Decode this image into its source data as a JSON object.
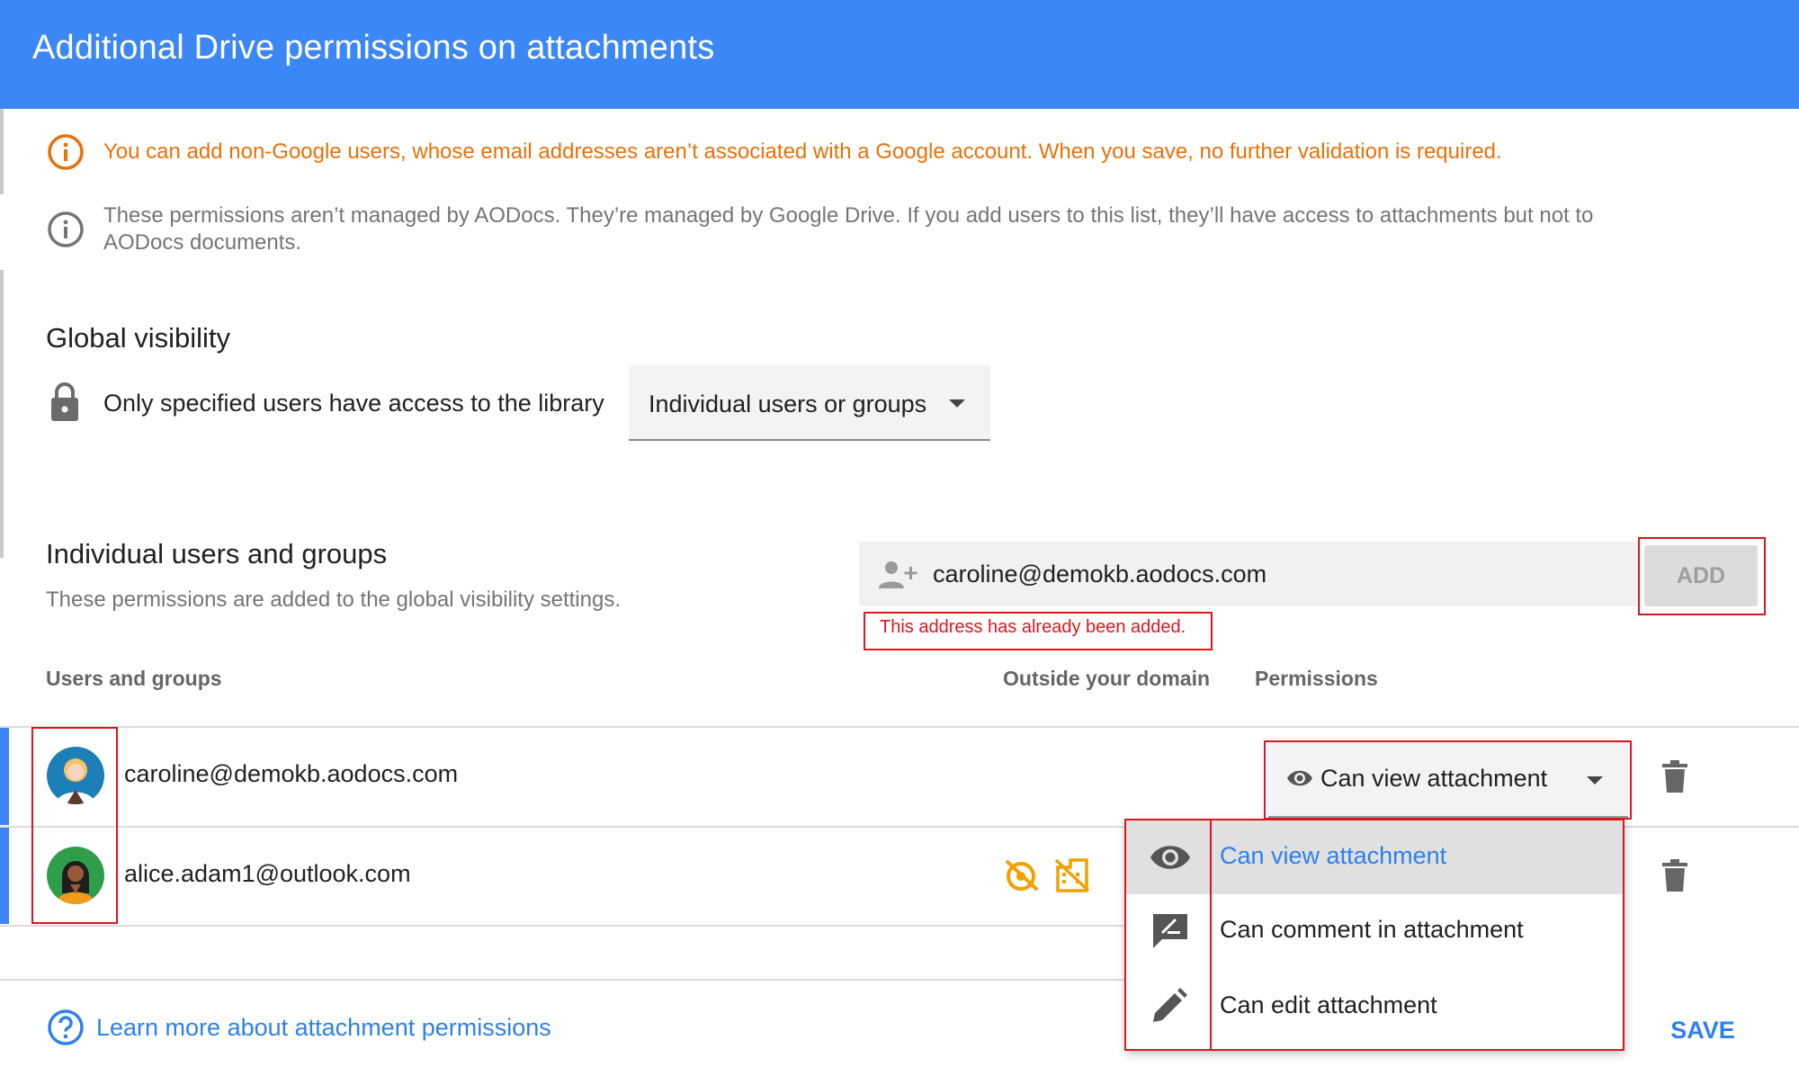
{
  "dialog": {
    "title": "Additional Drive permissions on attachments"
  },
  "notices": {
    "warning": "You can add non-Google users, whose email addresses aren’t associated with a Google account. When you save, no further validation is required.",
    "info_line1": "These permissions aren’t managed by AODocs. They’re managed by Google Drive. If you add users to this list, they’ll have access to attachments but not to",
    "info_line2": "AODocs documents."
  },
  "global_visibility": {
    "title": "Global visibility",
    "description": "Only specified users have access to the library",
    "selected": "Individual users or groups"
  },
  "individual": {
    "title": "Individual users and groups",
    "subtitle": "These permissions are added to the global visibility settings.",
    "email_value": "caroline@demokb.aodocs.com",
    "add_label": "ADD",
    "error": "This address has already been added."
  },
  "table": {
    "columns": {
      "users": "Users and groups",
      "outside": "Outside your domain",
      "permissions": "Permissions"
    },
    "rows": [
      {
        "email": "caroline@demokb.aodocs.com",
        "permission": "Can view attachment"
      },
      {
        "email": "alice.adam1@outlook.com"
      }
    ]
  },
  "permission_menu": {
    "items": [
      {
        "label": "Can view attachment",
        "icon": "eye-icon",
        "selected": true
      },
      {
        "label": "Can comment in attachment",
        "icon": "comment-edit-icon"
      },
      {
        "label": "Can edit attachment",
        "icon": "pencil-icon"
      }
    ]
  },
  "footer": {
    "learn_more": "Learn more about attachment permissions",
    "save_label": "SAVE"
  },
  "colors": {
    "header": "#3a87f5",
    "warning": "#e8710a",
    "link": "#2f80ed",
    "error": "#e0151d",
    "external_badge": "#f2a100"
  }
}
